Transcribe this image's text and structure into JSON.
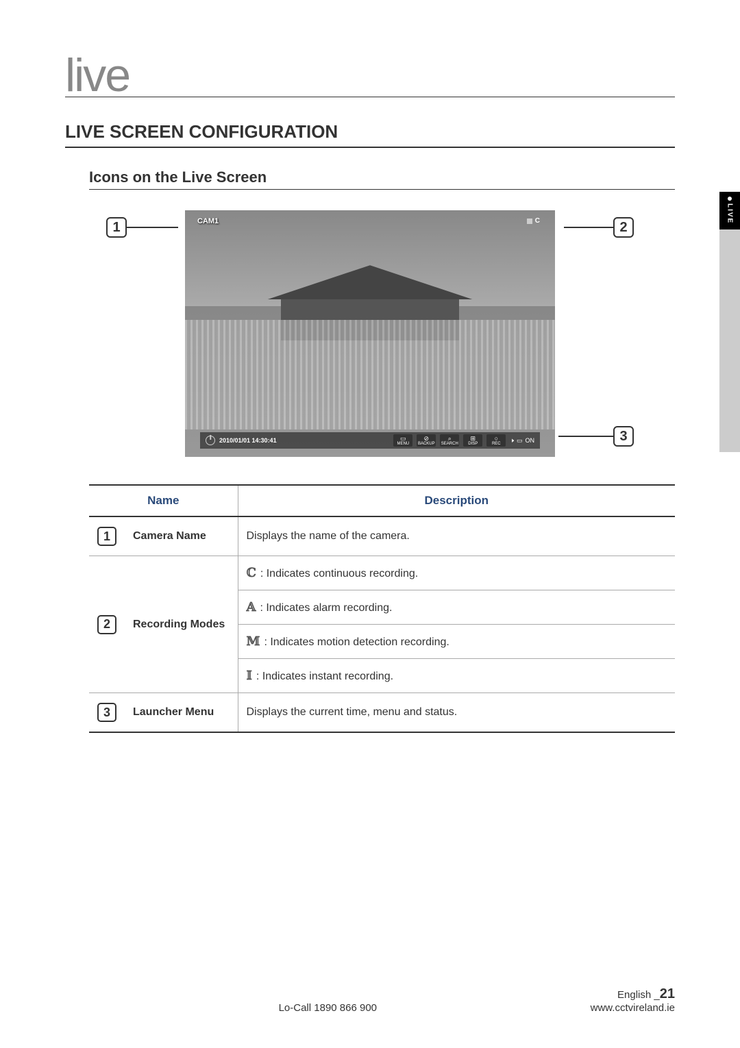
{
  "section_title": "live",
  "main_heading": "LIVE SCREEN CONFIGURATION",
  "sub_heading": "Icons on the Live Screen",
  "side_tab": "LIVE",
  "screenshot": {
    "cam_label": "CAM1",
    "rec_letter": "C",
    "timestamp": "2010/01/01 14:30:41",
    "menu_items": [
      "MENU",
      "BACKUP",
      "SEARCH",
      "DISP",
      "REC"
    ],
    "status_end": "ON"
  },
  "callouts": {
    "c1": "1",
    "c2": "2",
    "c3": "3"
  },
  "table": {
    "headers": {
      "name": "Name",
      "desc": "Description"
    },
    "rows": [
      {
        "num": "1",
        "name": "Camera Name",
        "desc": "Displays the name of the camera."
      },
      {
        "num": "2",
        "name": "Recording Modes",
        "modes": [
          {
            "icon": "ℂ",
            "text": ": Indicates continuous recording."
          },
          {
            "icon": "𝔸",
            "text": ": Indicates alarm recording."
          },
          {
            "icon": "𝕄",
            "text": ": Indicates motion detection recording."
          },
          {
            "icon": "𝕀",
            "text": ": Indicates instant recording."
          }
        ]
      },
      {
        "num": "3",
        "name": "Launcher Menu",
        "desc": "Displays the current time, menu and status."
      }
    ]
  },
  "footer": {
    "locall": "Lo-Call  1890 866 900",
    "lang": "English _",
    "page": "21",
    "url": "www.cctvireland.ie"
  }
}
